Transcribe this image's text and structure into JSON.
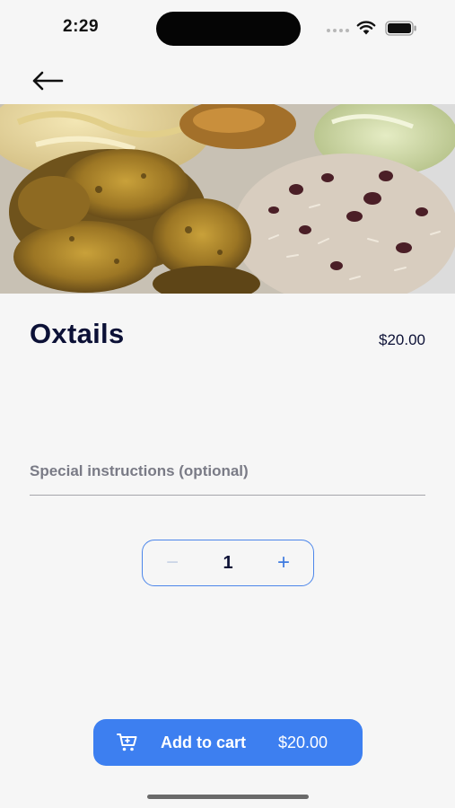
{
  "status_bar": {
    "time": "2:29",
    "icons": [
      "cellular-signal-icon",
      "wifi-icon",
      "battery-icon"
    ]
  },
  "nav": {
    "back_icon": "arrow-left-icon"
  },
  "item": {
    "name": "Oxtails",
    "price": "$20.00",
    "image_icon": "food-photo"
  },
  "instructions": {
    "placeholder": "Special instructions (optional)",
    "value": ""
  },
  "quantity": {
    "value": "1",
    "decrement_label": "−",
    "increment_label": "+"
  },
  "add_to_cart": {
    "label": "Add to cart",
    "price": "$20.00",
    "icon": "cart-icon"
  },
  "colors": {
    "accent": "#3d7ff0",
    "background": "#f6f6f6",
    "title": "#0c1136",
    "placeholder": "#7a7b86"
  }
}
